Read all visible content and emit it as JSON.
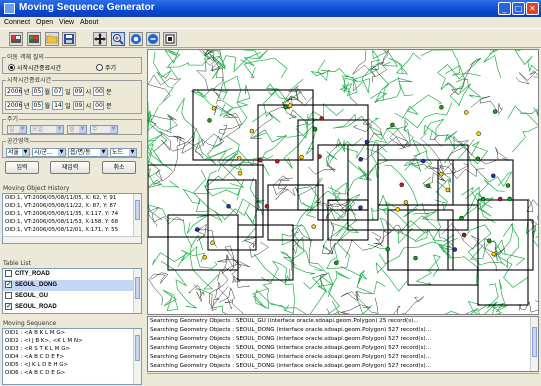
{
  "window": {
    "title": "Moving Sequence Generator",
    "min": "_",
    "max": "□",
    "close": "✕"
  },
  "menu": [
    "Connect",
    "Open",
    "View",
    "About"
  ],
  "query_mode": {
    "label": "이동 객체 질의",
    "opt1": "시작시간종료시간",
    "opt2": "주기"
  },
  "time_range": {
    "label": "시작시간종료시간",
    "start": {
      "year": "2006",
      "month": "05",
      "day": "07",
      "hour": "09",
      "min": "00"
    },
    "end": {
      "year": "2006",
      "month": "05",
      "day": "14",
      "hour": "09",
      "min": "00"
    },
    "units": {
      "year": "년",
      "month": "월",
      "day": "일",
      "hour": "시",
      "min": "분"
    }
  },
  "period": {
    "label": "주기",
    "c1": "일",
    "c2": "요일",
    "c3": "월",
    "c4": "주"
  },
  "region": {
    "label": "공간영역",
    "c1": "서울",
    "c2": "시/군...",
    "c3": "읍/면/동",
    "c4": "노드"
  },
  "buttons": {
    "input": "입력",
    "reinput": "재입력",
    "cancel": "취소"
  },
  "history": {
    "title": "Moving Object History",
    "lines": [
      "OID:1, VT:2006/05/08/11/05, X: 62, Y: 91",
      "OID:1, VT:2006/05/08/11/22, X: 87, Y: 87",
      "OID:1, VT:2006/05/08/11/35, X:117, Y: 74",
      "OID:1, VT:2006/05/08/11/53, X:158, Y: 68",
      "OID:1, VT:2006/05/08/12/01, X:171, Y: 55"
    ]
  },
  "table_list": {
    "title": "Table List",
    "items": [
      {
        "name": "CITY_ROAD",
        "checked": false,
        "selected": false
      },
      {
        "name": "SEOUL_DONG",
        "checked": true,
        "selected": true
      },
      {
        "name": "SEOUL_GU",
        "checked": false,
        "selected": false
      },
      {
        "name": "SEOUL_ROAD",
        "checked": true,
        "selected": false
      }
    ]
  },
  "sequence": {
    "title": "Moving Sequence",
    "lines": [
      "OID1 : <A B K L M G>",
      "OID2 : <I J B K>, <K L M N>",
      "OID3 : <R S T K L M G>",
      "OID4 : <A B C D E F>",
      "OID5 : <J K L D E H G>",
      "OID6 : <A B C D E G>"
    ]
  },
  "log": [
    "Searching Geometry Objects : SEOUL_GU (interface oracle.sdoapi.geom.Polygon) 25 record(s)...",
    "Searching Geometry Objects : SEOUL_DONG (interface oracle.sdoapi.geom.Polygon) 527 record(s)...",
    "Searching Geometry Objects : SEOUL_DONG (interface oracle.sdoapi.geom.Polygon) 527 record(s)...",
    "Searching Geometry Objects : SEOUL_DONG (interface oracle.sdoapi.geom.Polygon) 527 record(s)...",
    "Searching Geometry Objects : SEOUL_DONG (interface oracle.sdoapi.geom.Polygon) 527 record(s)...",
    "Searching Geometry Objects : SEOUL_DONG (interface oracle.sdoapi.geom.Polygon) 527 record(s)..."
  ],
  "toolbar_icons": [
    "connect-db-icon",
    "disconnect-db-icon",
    "open-folder-icon",
    "save-icon",
    "pan-icon",
    "zoom-in-icon",
    "zoom-full-icon",
    "zoom-out-icon",
    "select-icon"
  ],
  "colors": {
    "road": "#22b04a",
    "boundary": "#303030",
    "mbr": "#000000",
    "titlebar": "#0a48d0"
  }
}
